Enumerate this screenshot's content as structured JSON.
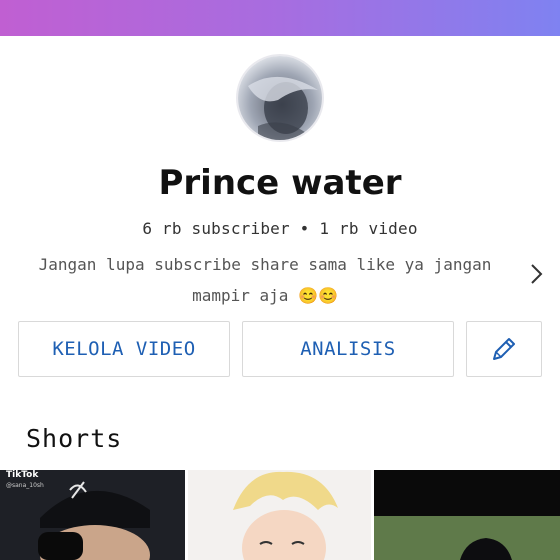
{
  "header": {
    "gradient_start": "#c05fd2",
    "gradient_end": "#7f82f1"
  },
  "channel": {
    "avatar_icon": "avatar-photo",
    "name": "Prince water",
    "stats": "6 rb subscriber • 1 rb video",
    "description_line1": "Jangan lupa subscribe share sama like ya jangan",
    "description_line2": "mampir aja 😊😊"
  },
  "actions": {
    "manage_videos_label": "KELOLA VIDEO",
    "analytics_label": "ANALISIS",
    "edit_icon": "pencil-icon"
  },
  "shorts": {
    "title": "Shorts",
    "items": [
      {
        "watermark": "TikTok",
        "handle": "@sana_10sh"
      },
      {
        "watermark": ""
      },
      {
        "watermark": ""
      }
    ]
  },
  "colors": {
    "accent": "#1e5fb3"
  }
}
